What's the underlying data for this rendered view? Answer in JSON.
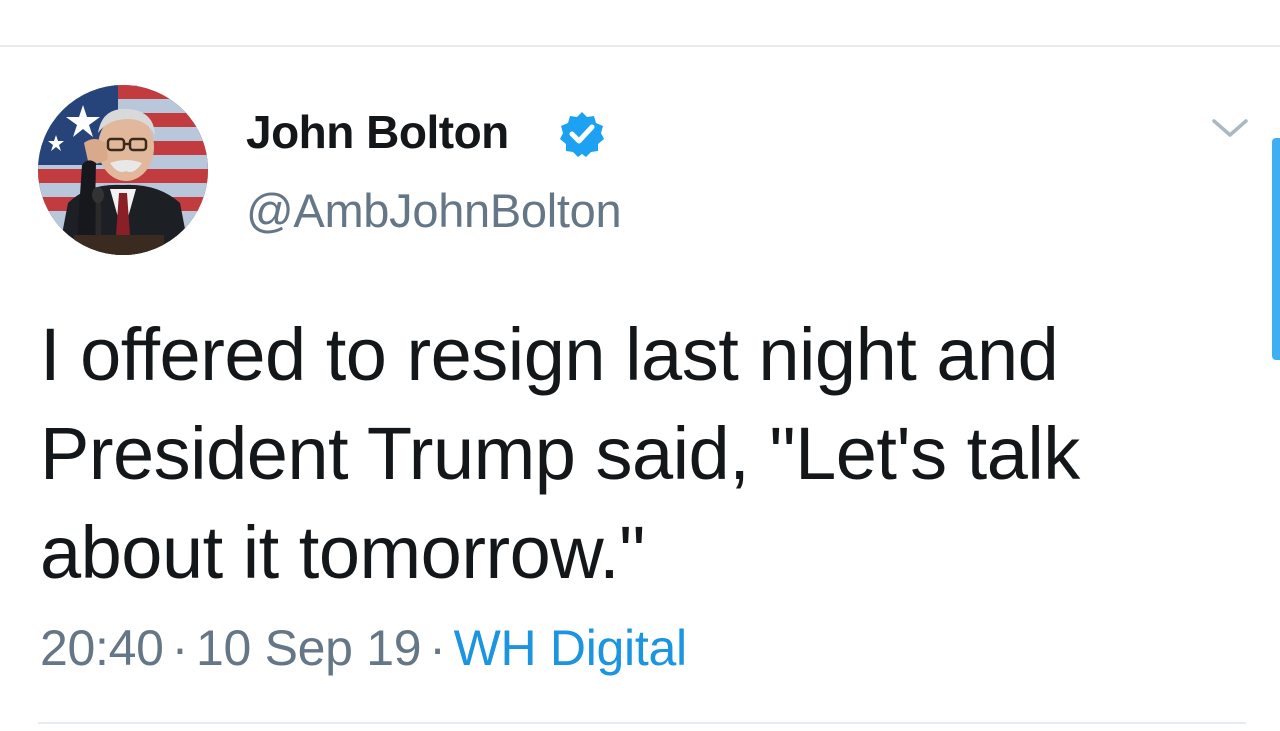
{
  "tweet": {
    "author_name": "John Bolton",
    "handle": "@AmbJohnBolton",
    "verified": true,
    "text": "I offered to resign last night and President Trump said, \"Let's talk about it tomorrow.\"",
    "time": "20:40",
    "separator": "·",
    "date": "10 Sep 19",
    "source": "WH Digital"
  },
  "icons": {
    "avatar": "avatar",
    "verified": "verified-badge-icon",
    "more": "chevron-down-icon"
  },
  "colors": {
    "text_primary": "#14171a",
    "text_secondary": "#657786",
    "link": "#1b95e0",
    "verified": "#1da1f2",
    "divider": "#e6ecf0"
  }
}
